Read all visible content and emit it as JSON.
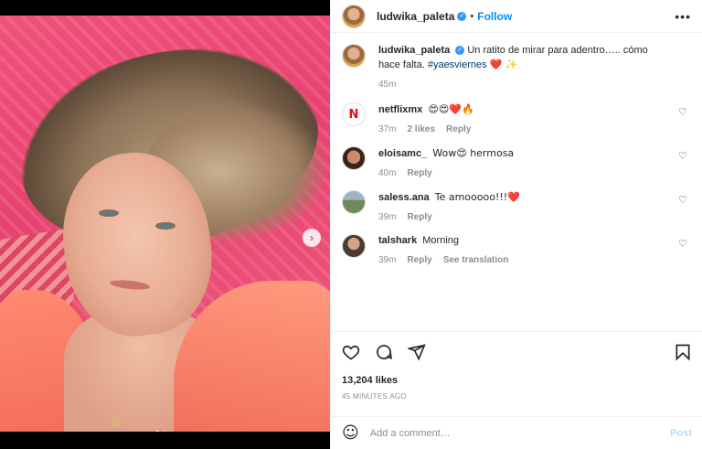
{
  "post": {
    "username": "ludwika_paleta",
    "separator": "•",
    "follow_label": "Follow",
    "more_label": "•••",
    "caption_text": "Un ratito de mirar para adentro….. cómo hace falta.",
    "caption_tag": "#yaesviernes",
    "caption_emoji": "❤️ ✨",
    "caption_time": "45m"
  },
  "comments": [
    {
      "username": "netflixmx",
      "text": "😍😍❤️🔥",
      "time": "37m",
      "likes": "2 likes",
      "reply": "Reply",
      "avatar_icon": "netflix-logo-icon"
    },
    {
      "username": "eloisamc_",
      "text": "Wow😍 hermosa",
      "time": "40m",
      "reply": "Reply"
    },
    {
      "username": "saless.ana",
      "text": "Te amooooo!!!❤️",
      "time": "39m",
      "reply": "Reply"
    },
    {
      "username": "talshark",
      "text": "Morning",
      "time": "39m",
      "reply": "Reply",
      "translate": "See translation"
    }
  ],
  "actions": {
    "likes": "13,204 likes",
    "timestamp": "45 MINUTES AGO"
  },
  "add_comment": {
    "placeholder": "Add a comment…",
    "post_label": "Post"
  },
  "colors": {
    "accent": "#0095f6",
    "verified": "#3897f0",
    "muted": "#8e8e8e",
    "post_disabled": "#b2dffc"
  },
  "carousel": {
    "slide_count": 2,
    "active_slide": 1
  }
}
